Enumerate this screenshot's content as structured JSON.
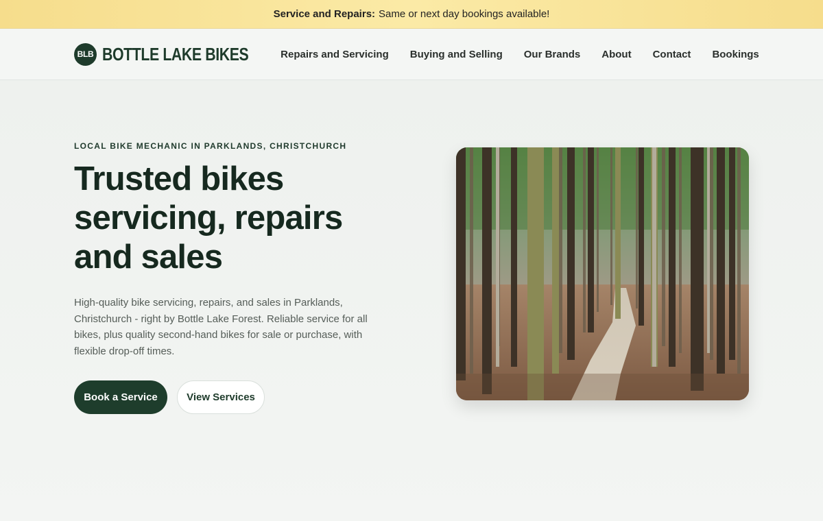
{
  "announcement": {
    "bold": "Service and Repairs:",
    "text": "Same or next day bookings available!"
  },
  "brand": {
    "badge": "BLB",
    "name": "BOTTLE LAKE BIKES"
  },
  "nav": [
    {
      "label": "Repairs and Servicing"
    },
    {
      "label": "Buying and Selling"
    },
    {
      "label": "Our Brands"
    },
    {
      "label": "About"
    },
    {
      "label": "Contact"
    },
    {
      "label": "Bookings"
    }
  ],
  "hero": {
    "eyebrow": "LOCAL BIKE MECHANIC IN PARKLANDS, CHRISTCHURCH",
    "headline": "Trusted bikes servicing, repairs and sales",
    "lede": "High-quality bike servicing, repairs, and sales in Parklands, Christchurch - right by Bottle Lake Forest. Reliable service for all bikes, plus quality second-hand bikes for sale or purchase, with flexible drop-off times.",
    "primary_cta": "Book a Service",
    "secondary_cta": "View Services"
  },
  "colors": {
    "announcement_bg": "#f6dd8c",
    "brand_green": "#1e3b2b",
    "page_bg": "#f3f5f3"
  }
}
